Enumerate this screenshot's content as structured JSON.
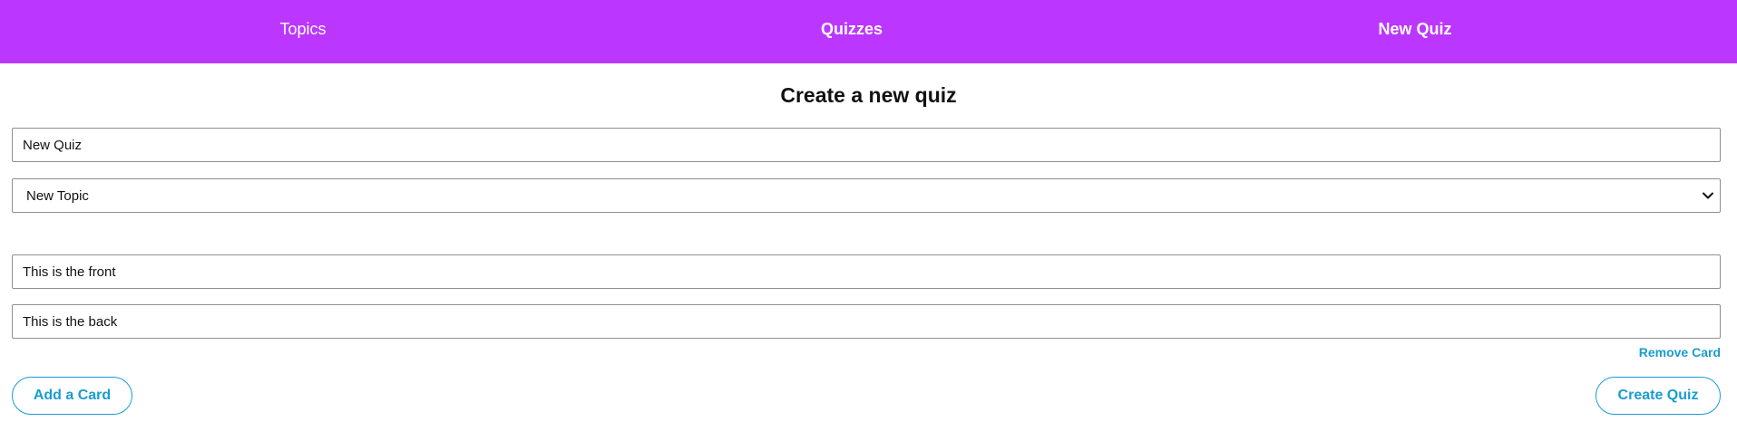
{
  "nav": {
    "topics": "Topics",
    "quizzes": "Quizzes",
    "new_quiz": "New Quiz",
    "background_color": "#bb36ff"
  },
  "form": {
    "title": "Create a new quiz",
    "quiz_name_value": "New Quiz",
    "topic_select": {
      "selected": "New Topic",
      "icon": "chevron-down-icon"
    },
    "cards": [
      {
        "front_value": "This is the front",
        "back_value": "This is the back",
        "remove_label": "Remove Card"
      }
    ],
    "add_card_label": "Add a Card",
    "create_quiz_label": "Create Quiz",
    "accent_color": "#1a9ccf"
  }
}
